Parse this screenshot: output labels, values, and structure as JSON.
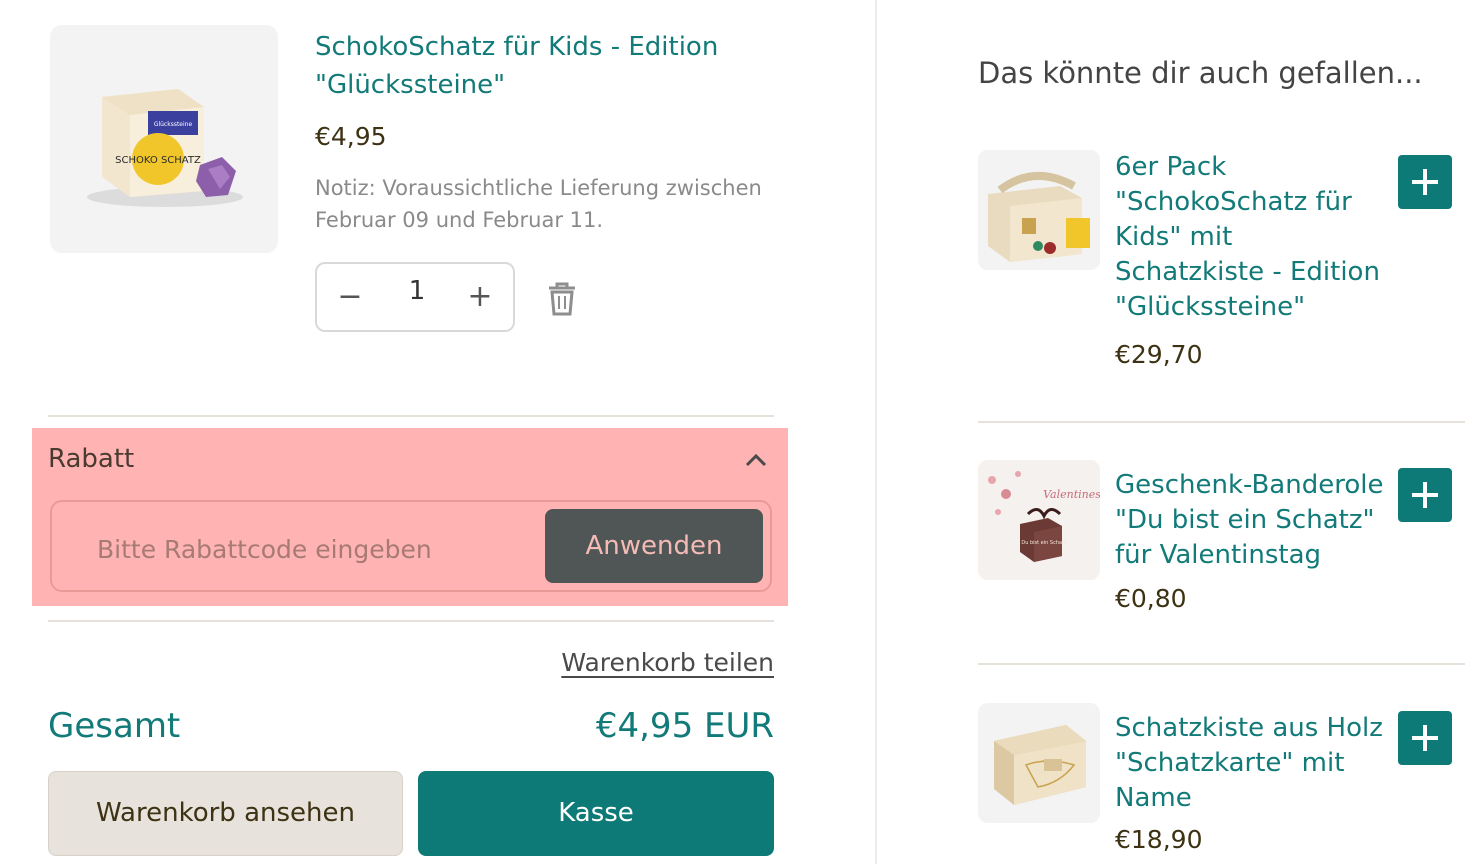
{
  "cart_item": {
    "title": "SchokoSchatz für Kids - Edition \"Glückssteine\"",
    "price": "€4,95",
    "note": "Notiz: Voraussichtliche Lieferung zwischen Februar 09 und Februar 11.",
    "quantity": "1",
    "minus_label": "−",
    "plus_label": "+",
    "box_brand": "SCHOKO SCHATZ",
    "box_tag": "Glückssteine"
  },
  "discount": {
    "label": "Rabatt",
    "placeholder": "Bitte Rabattcode eingeben",
    "apply_label": "Anwenden"
  },
  "share_label": "Warenkorb teilen",
  "total": {
    "label": "Gesamt",
    "value": "€4,95 EUR"
  },
  "buttons": {
    "view_cart": "Warenkorb ansehen",
    "checkout": "Kasse"
  },
  "recommendations": {
    "heading": "Das könnte dir auch gefallen...",
    "items": [
      {
        "title": "6er Pack \"SchokoSchatz für Kids\" mit Schatzkiste - Edition \"Glückssteine\"",
        "price": "€29,70"
      },
      {
        "title": "Geschenk-Banderole \"Du bist ein Schatz\" für Valentinstag",
        "price": "€0,80",
        "image_text": "Valentines",
        "box_text": "Du bist ein Schatz"
      },
      {
        "title": "Schatzkiste aus Holz \"Schatzkarte\" mit Name",
        "price": "€18,90"
      }
    ]
  },
  "colors": {
    "accent": "#0e7a78",
    "highlight": "#ffb3b3",
    "apply_button": "#4f5655"
  }
}
